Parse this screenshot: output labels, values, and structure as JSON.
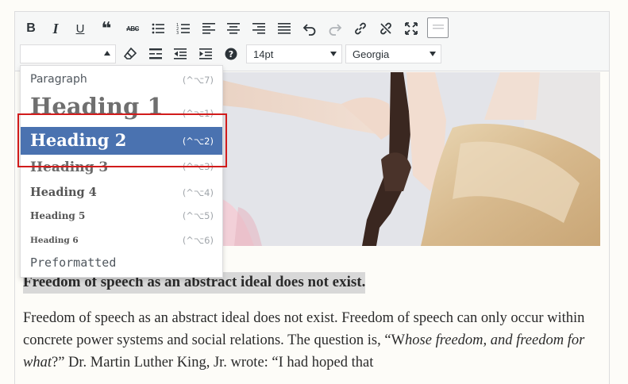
{
  "toolbar": {
    "row1": [
      {
        "name": "bold-button",
        "glyph": "B"
      },
      {
        "name": "italic-button",
        "glyph": "I"
      },
      {
        "name": "underline-button",
        "glyph": "U"
      },
      {
        "name": "blockquote-button",
        "glyph": "❝"
      },
      {
        "name": "strikethrough-button",
        "glyph": "ABC"
      }
    ],
    "format_select_value": "",
    "font_size_value": "14pt",
    "font_family_value": "Georgia"
  },
  "dropdown": {
    "items": [
      {
        "label": "Paragraph",
        "shortcut": "(^⌥7)"
      },
      {
        "label": "Heading 1",
        "shortcut": "(^⌥1)"
      },
      {
        "label": "Heading 2",
        "shortcut": "(^⌥2)"
      },
      {
        "label": "Heading 3",
        "shortcut": "(^⌥3)"
      },
      {
        "label": "Heading 4",
        "shortcut": "(^⌥4)"
      },
      {
        "label": "Heading 5",
        "shortcut": "(^⌥5)"
      },
      {
        "label": "Heading 6",
        "shortcut": "(^⌥6)"
      },
      {
        "label": "Preformatted",
        "shortcut": ""
      }
    ],
    "selected": "Heading 2"
  },
  "content": {
    "heading": "Freedom of speech as an abstract ideal does not exist.",
    "para_1": "Freedom of speech as an abstract ideal does not exist. Freedom of speech can only occur within concrete power systems and social relations. The question is, “W",
    "para_2": "hose freedom, and freedom for what",
    "para_3": "?” Dr. Martin Luther King, Jr. wrote: “I had hoped that"
  },
  "colors": {
    "selected_bg": "#4a72b0",
    "highlight_border": "#d11b1b"
  }
}
